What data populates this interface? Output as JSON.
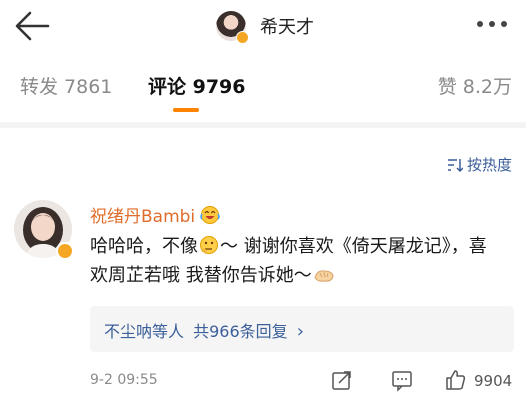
{
  "header": {
    "author_name": "希天才"
  },
  "tabs": {
    "repost": "转发 7861",
    "comment": "评论 9796",
    "like": "赞 8.2万"
  },
  "sort_label": "按热度",
  "comment": {
    "author": "祝绪丹Bambi",
    "text_part1": "哈哈哈，不像",
    "text_part2": "～ 谢谢你喜欢《倚天屠龙记》，喜欢周芷若哦 我替你告诉她～",
    "replies": {
      "users": "不尘呐等人",
      "count_text": "共966条回复",
      "arrow": "›"
    },
    "time": "9-2 09:55",
    "like_count": "9904"
  },
  "colors": {
    "accent": "#ff8200",
    "link": "#3b5f9a",
    "username": "#e06c2c",
    "verified": "#f5a623"
  },
  "icons": [
    "back-arrow-icon",
    "more-dots-icon",
    "sort-icon",
    "cry-laugh-emoji-icon",
    "thinking-emoji-icon",
    "clap-emoji-icon",
    "share-icon",
    "comment-icon",
    "like-icon"
  ]
}
